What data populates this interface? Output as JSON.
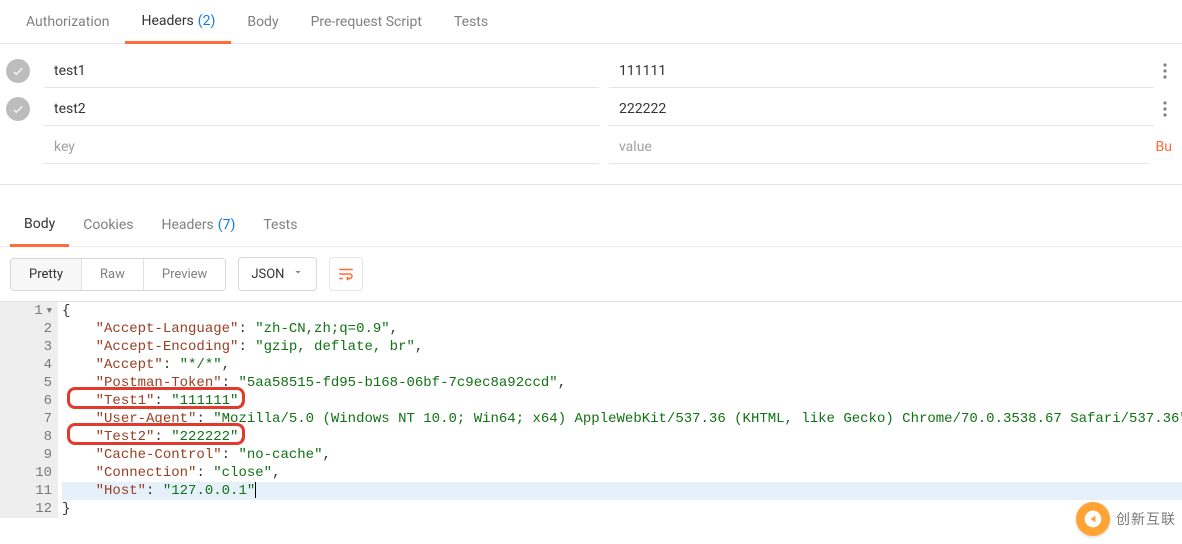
{
  "topTabs": {
    "authorization": "Authorization",
    "headers": "Headers",
    "headersCount": "(2)",
    "body": "Body",
    "preRequest": "Pre-request Script",
    "tests": "Tests"
  },
  "headersTable": {
    "rows": [
      {
        "key": "test1",
        "value": "111111"
      },
      {
        "key": "test2",
        "value": "222222"
      }
    ],
    "placeholder": {
      "key": "key",
      "value": "value"
    },
    "trailingAction": "Bu"
  },
  "respTabs": {
    "body": "Body",
    "cookies": "Cookies",
    "headers": "Headers",
    "headersCount": "(7)",
    "tests": "Tests"
  },
  "viewModes": {
    "pretty": "Pretty",
    "raw": "Raw",
    "preview": "Preview"
  },
  "formatSelect": "JSON",
  "code": {
    "lines": [
      {
        "n": 1,
        "fold": true,
        "indent": 0,
        "type": "open",
        "text": "{"
      },
      {
        "n": 2,
        "indent": 1,
        "type": "kv",
        "k": "Accept-Language",
        "v": "zh-CN,zh;q=0.9",
        "comma": true
      },
      {
        "n": 3,
        "indent": 1,
        "type": "kv",
        "k": "Accept-Encoding",
        "v": "gzip, deflate, br",
        "comma": true
      },
      {
        "n": 4,
        "indent": 1,
        "type": "kv",
        "k": "Accept",
        "v": "*/*",
        "comma": true
      },
      {
        "n": 5,
        "indent": 1,
        "type": "kv",
        "k": "Postman-Token",
        "v": "5aa58515-fd95-b168-06bf-7c9ec8a92ccd",
        "comma": true
      },
      {
        "n": 6,
        "indent": 1,
        "type": "kv",
        "k": "Test1",
        "v": "111111",
        "comma": true
      },
      {
        "n": 7,
        "indent": 1,
        "type": "kv",
        "k": "User-Agent",
        "v": "Mozilla/5.0 (Windows NT 10.0; Win64; x64) AppleWebKit/537.36 (KHTML, like Gecko) Chrome/70.0.3538.67 Safari/537.36",
        "comma": true
      },
      {
        "n": 8,
        "indent": 1,
        "type": "kv",
        "k": "Test2",
        "v": "222222",
        "comma": true
      },
      {
        "n": 9,
        "indent": 1,
        "type": "kv",
        "k": "Cache-Control",
        "v": "no-cache",
        "comma": true
      },
      {
        "n": 10,
        "indent": 1,
        "type": "kv",
        "k": "Connection",
        "v": "close",
        "comma": true
      },
      {
        "n": 11,
        "indent": 1,
        "type": "kv",
        "k": "Host",
        "v": "127.0.0.1",
        "comma": false,
        "hl": true,
        "caret": true
      },
      {
        "n": 12,
        "indent": 0,
        "type": "close",
        "text": "}"
      }
    ]
  },
  "watermark": "创新互联"
}
